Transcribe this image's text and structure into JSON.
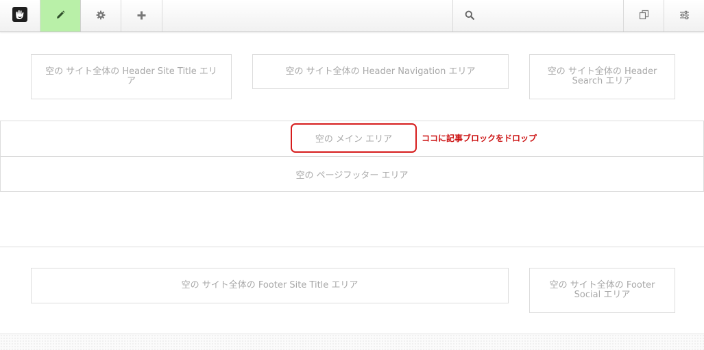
{
  "toolbar": {
    "search": {
      "placeholder": "",
      "value": ""
    },
    "icons": {
      "logo": "concrete5-logo-icon",
      "edit": "pencil-icon",
      "settings": "gear-icon",
      "add": "plus-icon",
      "search": "search-icon",
      "pages": "pages-icon",
      "dashboard": "sliders-icon"
    },
    "colors": {
      "edit_active_bg": "#b9f0a8",
      "border": "#dadada"
    }
  },
  "areas": {
    "header_site_title": "空の サイト全体の Header Site Title エリア",
    "header_navigation": "空の サイト全体の Header Navigation エリア",
    "header_search": "空の サイト全体の Header Search エリア",
    "main": "空の メイン エリア",
    "page_footer": "空の ページフッター エリア",
    "footer_site_title": "空の サイト全体の Footer Site Title エリア",
    "footer_social": "空の サイト全体の Footer Social エリア"
  },
  "annotation": {
    "text": "ココに記事ブロックをドロップ",
    "color": "#cc1111"
  }
}
